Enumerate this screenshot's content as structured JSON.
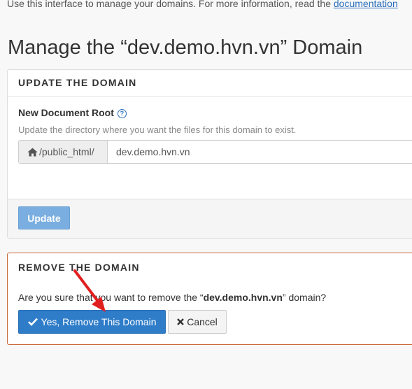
{
  "intro": {
    "text": "Use this interface to manage your domains. For more information, read the ",
    "link": "documentation"
  },
  "page_title": "Manage the “dev.demo.hvn.vn” Domain",
  "update_panel": {
    "heading": "UPDATE THE DOMAIN",
    "field_label": "New Document Root",
    "help_text": "Update the directory where you want the files for this domain to exist.",
    "path_prefix": "/public_html/",
    "input_value": "dev.demo.hvn.vn",
    "update_label": "Update"
  },
  "remove_panel": {
    "heading": "REMOVE THE DOMAIN",
    "confirm_before": "Are you sure that you want to remove the “",
    "confirm_domain": "dev.demo.hvn.vn",
    "confirm_after": "” domain?",
    "remove_label": "Yes, Remove This Domain",
    "cancel_label": "Cancel"
  },
  "colors": {
    "accent": "#2f7dc9",
    "update_button": "#7aaee0",
    "remove_border": "#c9663a",
    "annotation_arrow": "#e02020"
  },
  "icons": [
    "help-icon",
    "home-icon",
    "check-icon",
    "x-icon",
    "annotation-arrow"
  ]
}
